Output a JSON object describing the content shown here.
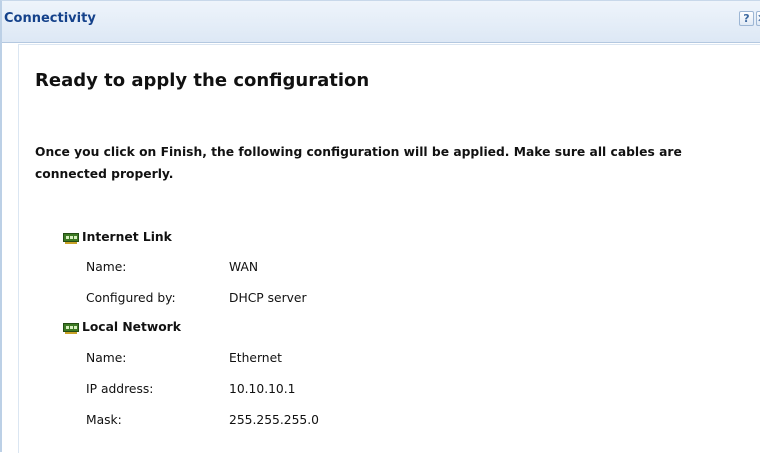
{
  "window": {
    "title": "Connectivity",
    "help_glyph": "?",
    "close_glyph": "✕"
  },
  "page": {
    "heading": "Ready to apply the configuration",
    "intro_line1": "Once you click on Finish, the following configuration will be applied. Make sure all cables are",
    "intro_line2": "connected properly."
  },
  "internet_link": {
    "title": "Internet Link",
    "rows": [
      {
        "label": "Name:",
        "value": "WAN"
      },
      {
        "label": "Configured by:",
        "value": "DHCP server"
      }
    ]
  },
  "local_network": {
    "title": "Local Network",
    "rows": [
      {
        "label": "Name:",
        "value": "Ethernet"
      },
      {
        "label": "IP address:",
        "value": "10.10.10.1"
      },
      {
        "label": "Mask:",
        "value": "255.255.255.0"
      }
    ]
  },
  "colors": {
    "title_text": "#15428b",
    "titlebar_bg": "#dde8f5",
    "nic_icon_green": "#3d7a24"
  },
  "icons": {
    "help": "help-icon",
    "close": "close-icon",
    "network_card": "network-card-icon"
  }
}
